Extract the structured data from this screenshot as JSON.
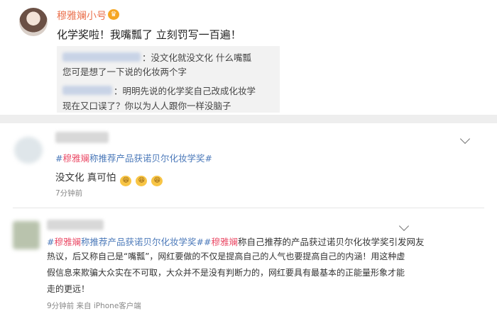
{
  "post": {
    "author": "穆雅斓小号",
    "badge_icon": "crown-icon",
    "text": "化学奖啦！我嘴瓢了 立刻罚写一百遍！",
    "quotes": [
      {
        "line1": "：没文化就没文化 什么嘴瓢",
        "line2": "您可是想了一下说的化妆两个字"
      },
      {
        "line1": "：明明先说的化学奖自己改成化妆学",
        "line2": "现在又口误了？你以为人人跟你一样没脑子"
      }
    ]
  },
  "comment1": {
    "tag_hash_open": "#",
    "tag_highlight": "穆雅斓",
    "tag_rest": "称推荐产品获诺贝尔化妆学奖#",
    "text": "没文化 真可怕",
    "emojis": [
      "😆",
      "😆",
      "😆"
    ],
    "time": "7分钟前"
  },
  "comment2": {
    "tag_hash_open": "#",
    "tag_highlight": "穆雅斓",
    "tag_rest": "称推荐产品获诺贝尔化妆学奖#",
    "tail_hash": "#",
    "tail_highlight": "穆雅斓",
    "line1_rest": "称自己推荐的产品获过诺贝尔化妆学奖引发网友",
    "line2": "热议，后又称自己是“嘴瓢”，网红要做的不仅是提高自己的人气也要提高自己的内涵！用这种虚",
    "line3": "假信息来欺骗大众实在不可取，大众并不是没有判断力的，网红要具有最基本的正能量形象才能",
    "line4": "走的更远！",
    "meta": "9分钟前  来自 iPhone客户端"
  },
  "colors": {
    "author_orange": "#eb7350",
    "hashtag_blue": "#4a78b9",
    "highlight_pink": "#eb4f6a"
  }
}
